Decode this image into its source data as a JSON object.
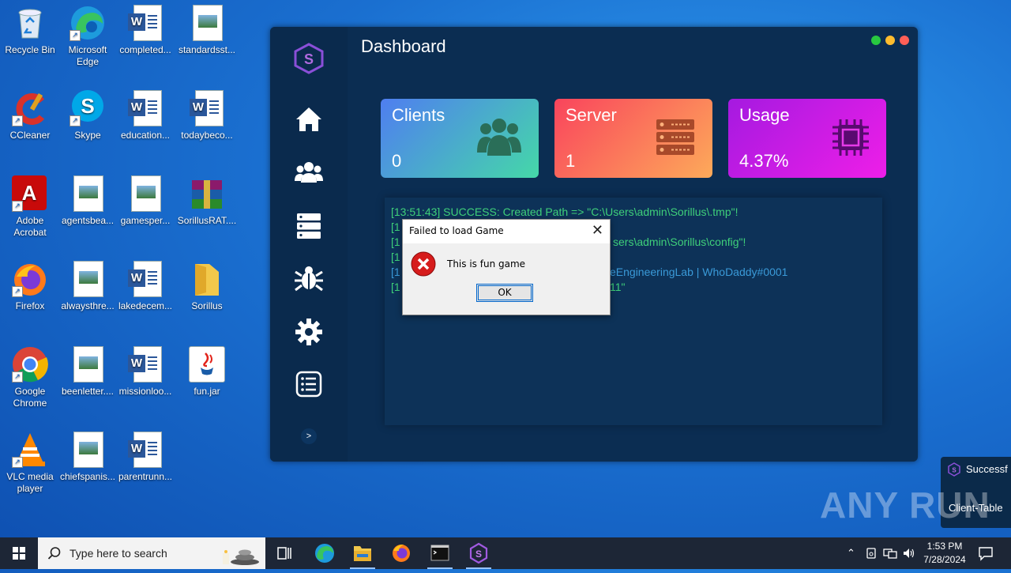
{
  "desktop": {
    "icons": [
      {
        "label": "Recycle Bin"
      },
      {
        "label": "Microsoft Edge"
      },
      {
        "label": "completed..."
      },
      {
        "label": "standardsst..."
      },
      {
        "label": "CCleaner"
      },
      {
        "label": "Skype"
      },
      {
        "label": "education..."
      },
      {
        "label": "todaybeco..."
      },
      {
        "label": "Adobe Acrobat"
      },
      {
        "label": "agentsbea..."
      },
      {
        "label": "gamesper..."
      },
      {
        "label": "SorillusRAT...."
      },
      {
        "label": "Firefox"
      },
      {
        "label": "alwaysthre..."
      },
      {
        "label": "lakedecem..."
      },
      {
        "label": "Sorillus"
      },
      {
        "label": "Google Chrome"
      },
      {
        "label": "beenletter...."
      },
      {
        "label": "missionloo..."
      },
      {
        "label": "fun.jar"
      },
      {
        "label": "VLC media player"
      },
      {
        "label": "chiefspanis..."
      },
      {
        "label": "parentrunn..."
      }
    ]
  },
  "app": {
    "title": "Dashboard",
    "cards": [
      {
        "title": "Clients",
        "value": "0",
        "icon": "users-icon"
      },
      {
        "title": "Server",
        "value": "1",
        "icon": "server-icon"
      },
      {
        "title": "Usage",
        "value": "4.37%",
        "icon": "cpu-icon"
      }
    ],
    "log": [
      "[13:51:43] SUCCESS: Created Path => \"C:\\Users\\admin\\Sorillus\\.tmp\"!",
      "[1",
      "[1",
      "[1",
      "[1",
      "[1"
    ],
    "log_tail": [
      "sers\\admin\\Sorillus\\config\"!",
      "eEngineeringLab | WhoDaddy#0001",
      "11\""
    ],
    "expand_label": ">"
  },
  "dialog": {
    "title": "Failed to load Game",
    "message": "This is fun game",
    "ok_label": "OK"
  },
  "taskbar": {
    "search_placeholder": "Type here to search",
    "time": "1:53 PM",
    "date": "7/28/2024"
  },
  "toast": {
    "title": "Successf",
    "subtitle": "Client-Table"
  },
  "watermark": "ANY RUN"
}
